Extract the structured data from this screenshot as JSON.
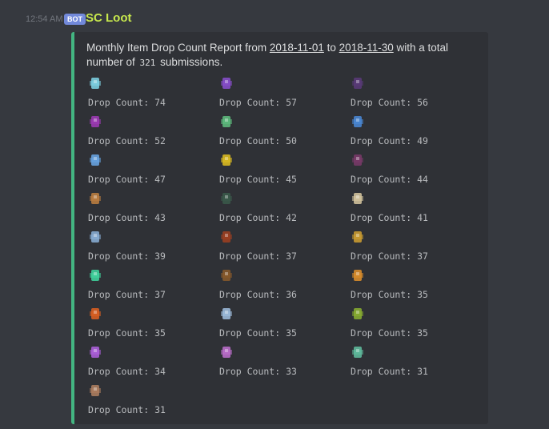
{
  "timestamp": "12:54 AM",
  "bot_tag": "BOT",
  "username": "SC Loot",
  "report": {
    "prefix": "Monthly Item Drop Count Report from ",
    "start_date": "2018-11-01",
    "to_word": " to ",
    "end_date": "2018-11-30",
    "mid": " with a total number of ",
    "total": "321",
    "suffix": " submissions."
  },
  "items": [
    {
      "label": "Drop Count: 74",
      "icon": "glowing-cube-icon",
      "color": "#7fd6e8"
    },
    {
      "label": "Drop Count: 57",
      "icon": "purple-wings-icon",
      "color": "#8a4fd0"
    },
    {
      "label": "Drop Count: 56",
      "icon": "dark-wings-icon",
      "color": "#5a3a7a"
    },
    {
      "label": "Drop Count: 52",
      "icon": "purple-boots-icon",
      "color": "#a03ab8"
    },
    {
      "label": "Drop Count: 50",
      "icon": "green-armor-icon",
      "color": "#5fbf7f"
    },
    {
      "label": "Drop Count: 49",
      "icon": "blue-vials-icon",
      "color": "#4a8ad8"
    },
    {
      "label": "Drop Count: 47",
      "icon": "blue-wand-icon",
      "color": "#6aa8e8"
    },
    {
      "label": "Drop Count: 45",
      "icon": "yellow-claws-icon",
      "color": "#e0c020"
    },
    {
      "label": "Drop Count: 44",
      "icon": "dark-boots-icon",
      "color": "#7a3a6a"
    },
    {
      "label": "Drop Count: 43",
      "icon": "orange-hammer-icon",
      "color": "#c08040"
    },
    {
      "label": "Drop Count: 42",
      "icon": "dark-robe-icon",
      "color": "#3a5a4a"
    },
    {
      "label": "Drop Count: 41",
      "icon": "bone-sickle-icon",
      "color": "#d8c8a0"
    },
    {
      "label": "Drop Count: 39",
      "icon": "blue-glider-icon",
      "color": "#8ab0d8"
    },
    {
      "label": "Drop Count: 37",
      "icon": "red-crawler-icon",
      "color": "#a04020"
    },
    {
      "label": "Drop Count: 37",
      "icon": "gold-crossbow-icon",
      "color": "#d0a030"
    },
    {
      "label": "Drop Count: 37",
      "icon": "green-orb-icon",
      "color": "#40d8a0"
    },
    {
      "label": "Drop Count: 36",
      "icon": "brown-beast-icon",
      "color": "#8a5a2a"
    },
    {
      "label": "Drop Count: 35",
      "icon": "orange-mace-icon",
      "color": "#e0902a"
    },
    {
      "label": "Drop Count: 35",
      "icon": "fire-armor-icon",
      "color": "#e06020"
    },
    {
      "label": "Drop Count: 35",
      "icon": "crystal-figure-icon",
      "color": "#a0c0e0"
    },
    {
      "label": "Drop Count: 35",
      "icon": "green-banner-icon",
      "color": "#8ab030"
    },
    {
      "label": "Drop Count: 34",
      "icon": "purple-bolt-icon",
      "color": "#b060e0"
    },
    {
      "label": "Drop Count: 33",
      "icon": "purple-potion-icon",
      "color": "#c070d0"
    },
    {
      "label": "Drop Count: 31",
      "icon": "teal-emblem-icon",
      "color": "#60c0a0"
    },
    {
      "label": "Drop Count: 31",
      "icon": "rusty-dagger-icon",
      "color": "#b08060"
    }
  ]
}
